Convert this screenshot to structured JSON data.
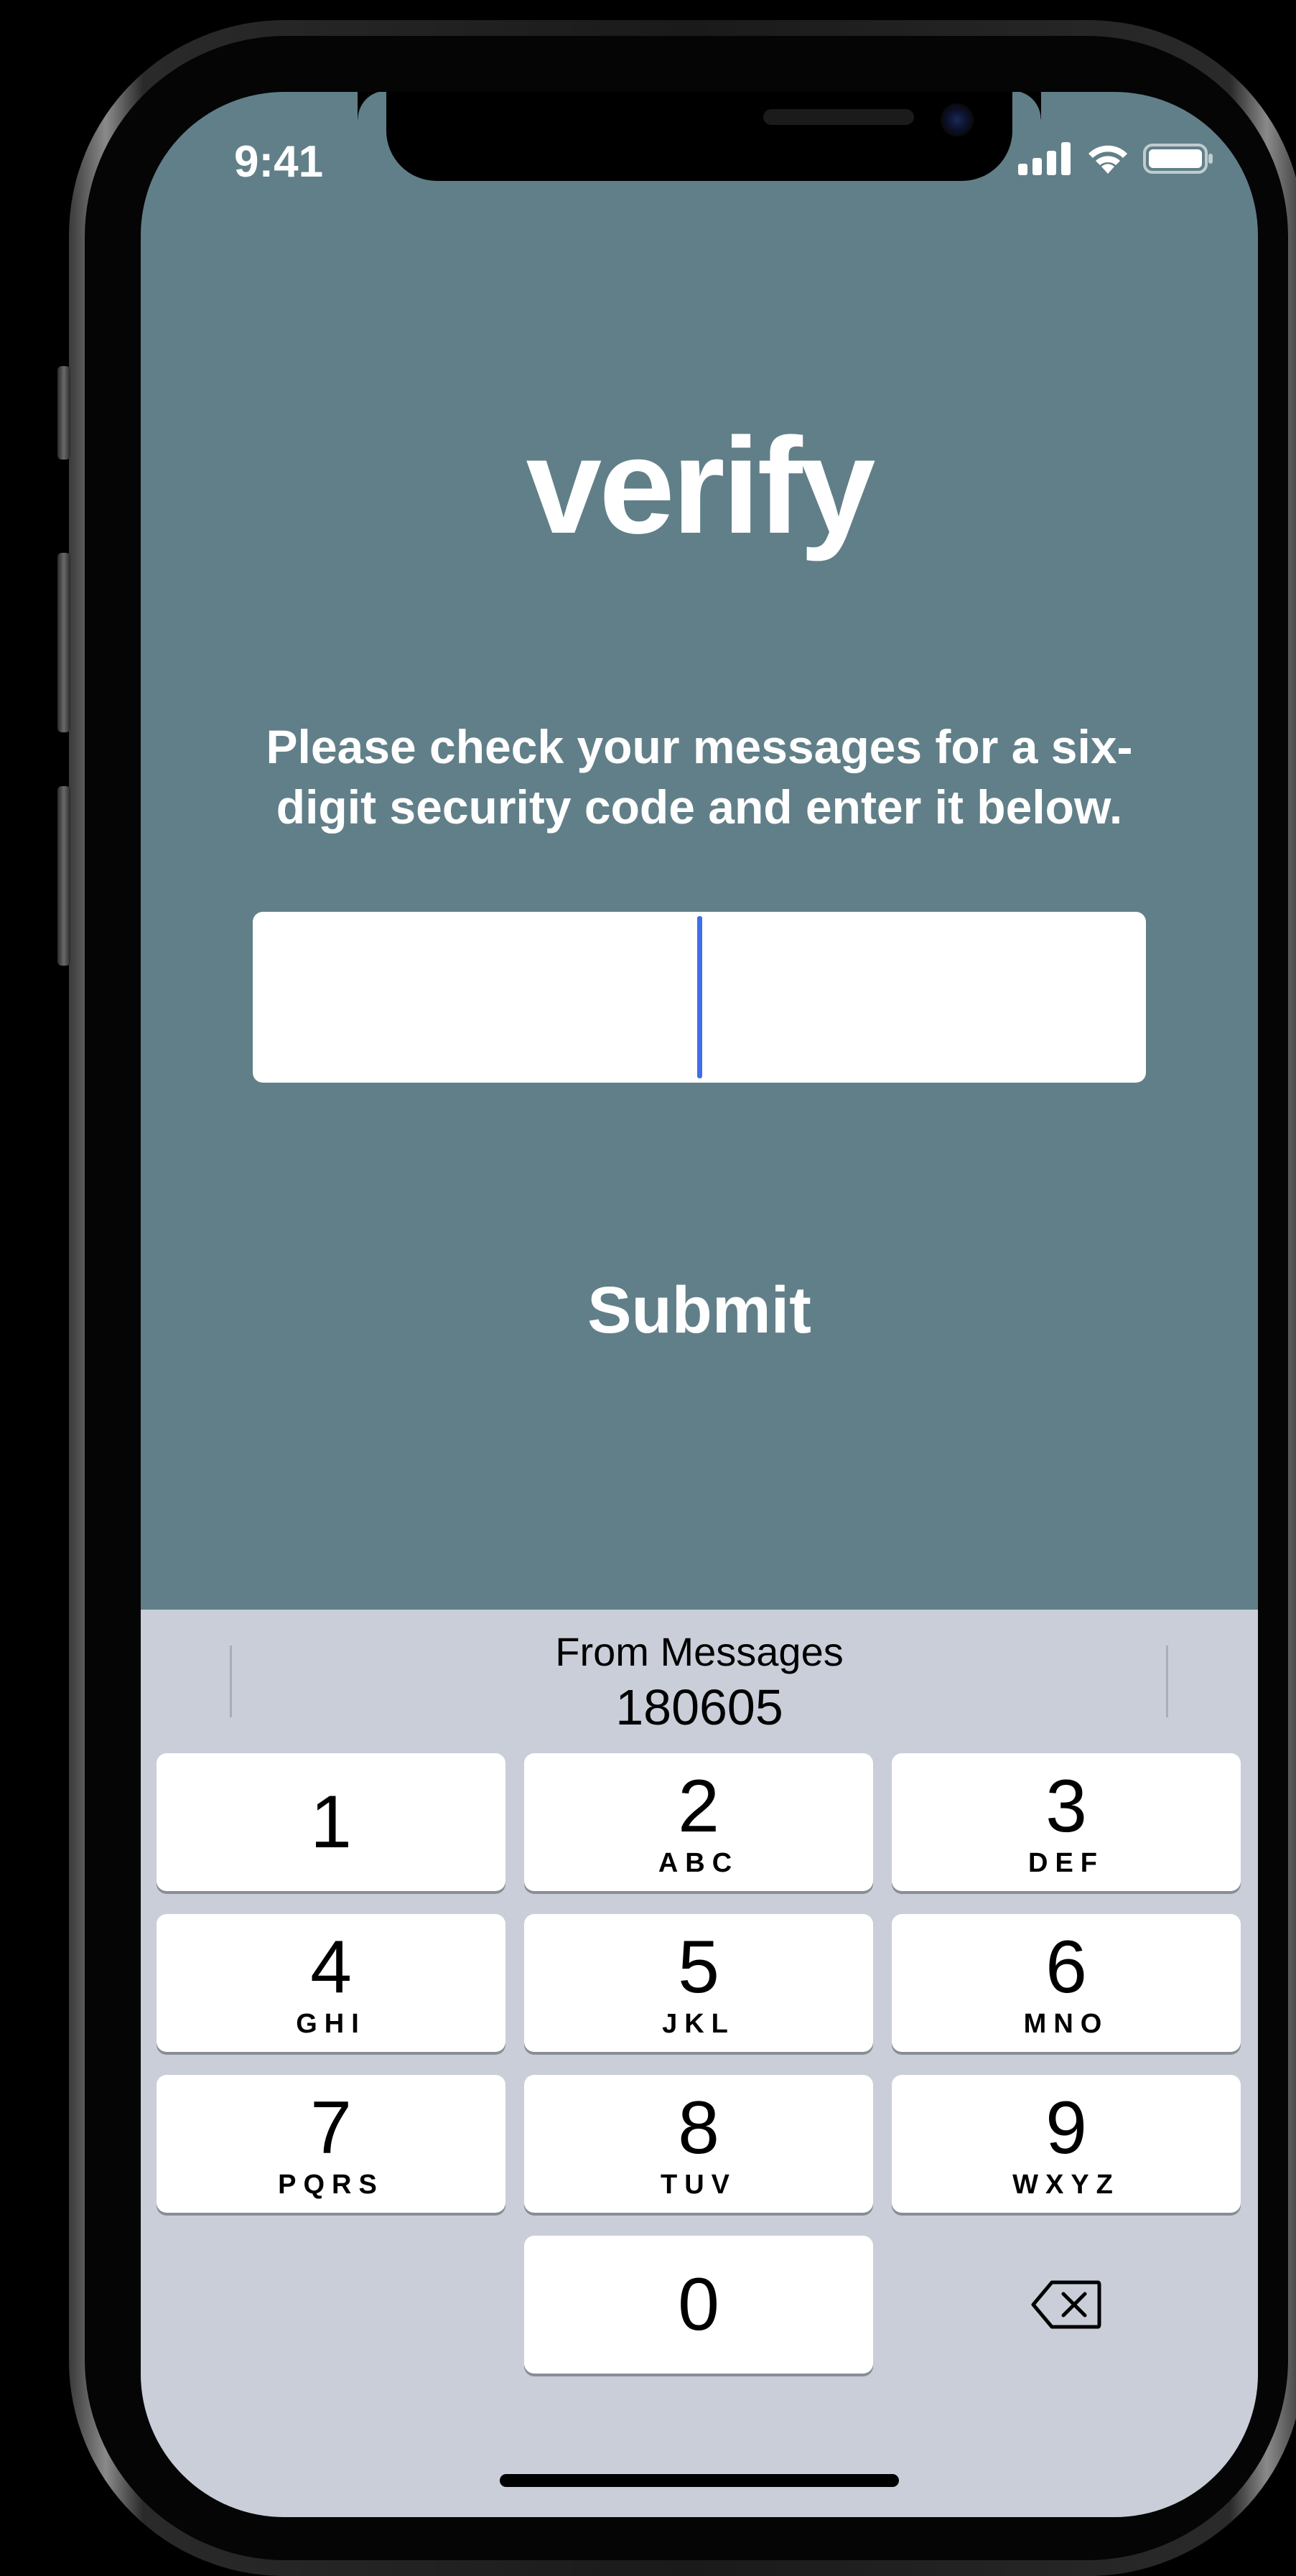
{
  "status_bar": {
    "time": "9:41",
    "icons": [
      "signal-icon",
      "wifi-icon",
      "battery-icon"
    ]
  },
  "app": {
    "title": "verify",
    "instructions_line1": "Please check your messages for a six-",
    "instructions_line2": "digit security code and enter it below.",
    "code_input_value": "",
    "submit_label": "Submit"
  },
  "keyboard": {
    "suggestion_source": "From Messages",
    "suggestion_code": "180605",
    "keys": [
      {
        "digit": "1",
        "letters": ""
      },
      {
        "digit": "2",
        "letters": "ABC"
      },
      {
        "digit": "3",
        "letters": "DEF"
      },
      {
        "digit": "4",
        "letters": "GHI"
      },
      {
        "digit": "5",
        "letters": "JKL"
      },
      {
        "digit": "6",
        "letters": "MNO"
      },
      {
        "digit": "7",
        "letters": "PQRS"
      },
      {
        "digit": "8",
        "letters": "TUV"
      },
      {
        "digit": "9",
        "letters": "WXYZ"
      },
      {
        "digit": "0",
        "letters": ""
      }
    ],
    "delete_icon": "delete-backward-icon"
  },
  "colors": {
    "app_background": "#617f88",
    "keyboard_background": "#c9ced8",
    "caret": "#3f6ee8",
    "text_on_app": "#ffffff"
  }
}
